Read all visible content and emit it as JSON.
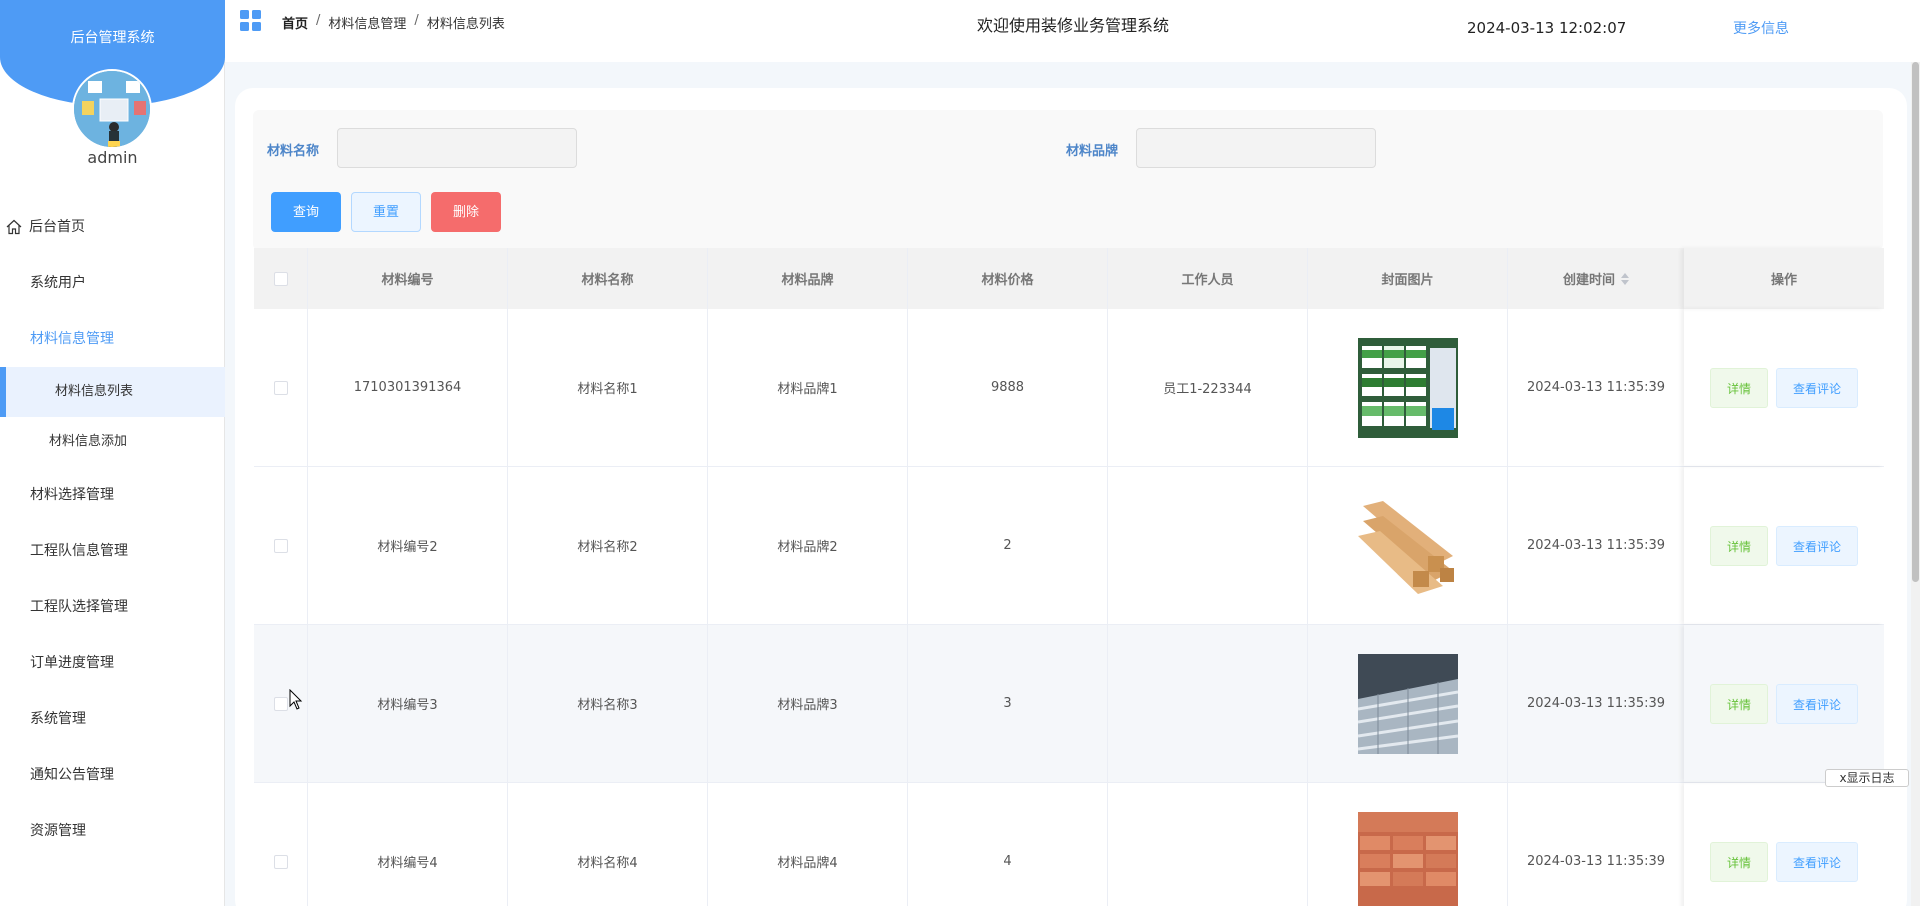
{
  "sidebar": {
    "title": "后台管理系统",
    "username": "admin",
    "menu": {
      "home": "后台首页",
      "system_users": "系统用户",
      "material_info": "材料信息管理",
      "material_list": "材料信息列表",
      "material_add": "材料信息添加",
      "material_select": "材料选择管理",
      "team_info": "工程队信息管理",
      "team_select": "工程队选择管理",
      "order_progress": "订单进度管理",
      "system_mgmt": "系统管理",
      "notice_mgmt": "通知公告管理",
      "resource_mgmt": "资源管理"
    }
  },
  "topbar": {
    "breadcrumb": [
      "首页",
      "材料信息管理",
      "材料信息列表"
    ],
    "separator": "/",
    "welcome": "欢迎使用装修业务管理系统",
    "datetime": "2024-03-13 12:02:07",
    "more_info": "更多信息"
  },
  "search": {
    "name_label": "材料名称",
    "name_value": "",
    "brand_label": "材料品牌",
    "brand_value": "",
    "query_btn": "查询",
    "reset_btn": "重置",
    "delete_btn": "删除"
  },
  "table": {
    "headers": [
      "材料编号",
      "材料名称",
      "材料品牌",
      "材料价格",
      "工作人员",
      "封面图片",
      "创建时间",
      "操作"
    ],
    "detail_btn": "详情",
    "comment_btn": "查看评论",
    "rows": [
      {
        "code": "1710301391364",
        "name": "材料名称1",
        "brand": "材料品牌1",
        "price": "9888",
        "staff": "员工1-223344",
        "image": "paint-buckets",
        "created": "2024-03-13 11:35:39"
      },
      {
        "code": "材料编号2",
        "name": "材料名称2",
        "brand": "材料品牌2",
        "price": "2",
        "staff": "",
        "image": "wood-beams",
        "created": "2024-03-13 11:35:39"
      },
      {
        "code": "材料编号3",
        "name": "材料名称3",
        "brand": "材料品牌3",
        "price": "3",
        "staff": "",
        "image": "steel-pipes",
        "created": "2024-03-13 11:35:39"
      },
      {
        "code": "材料编号4",
        "name": "材料名称4",
        "brand": "材料品牌4",
        "price": "4",
        "staff": "",
        "image": "bricks",
        "created": "2024-03-13 11:35:39"
      }
    ]
  },
  "log_button": "x显示日志",
  "colors": {
    "primary": "#4e9bf5",
    "danger": "#f56c6c",
    "success": "#67c23a"
  }
}
